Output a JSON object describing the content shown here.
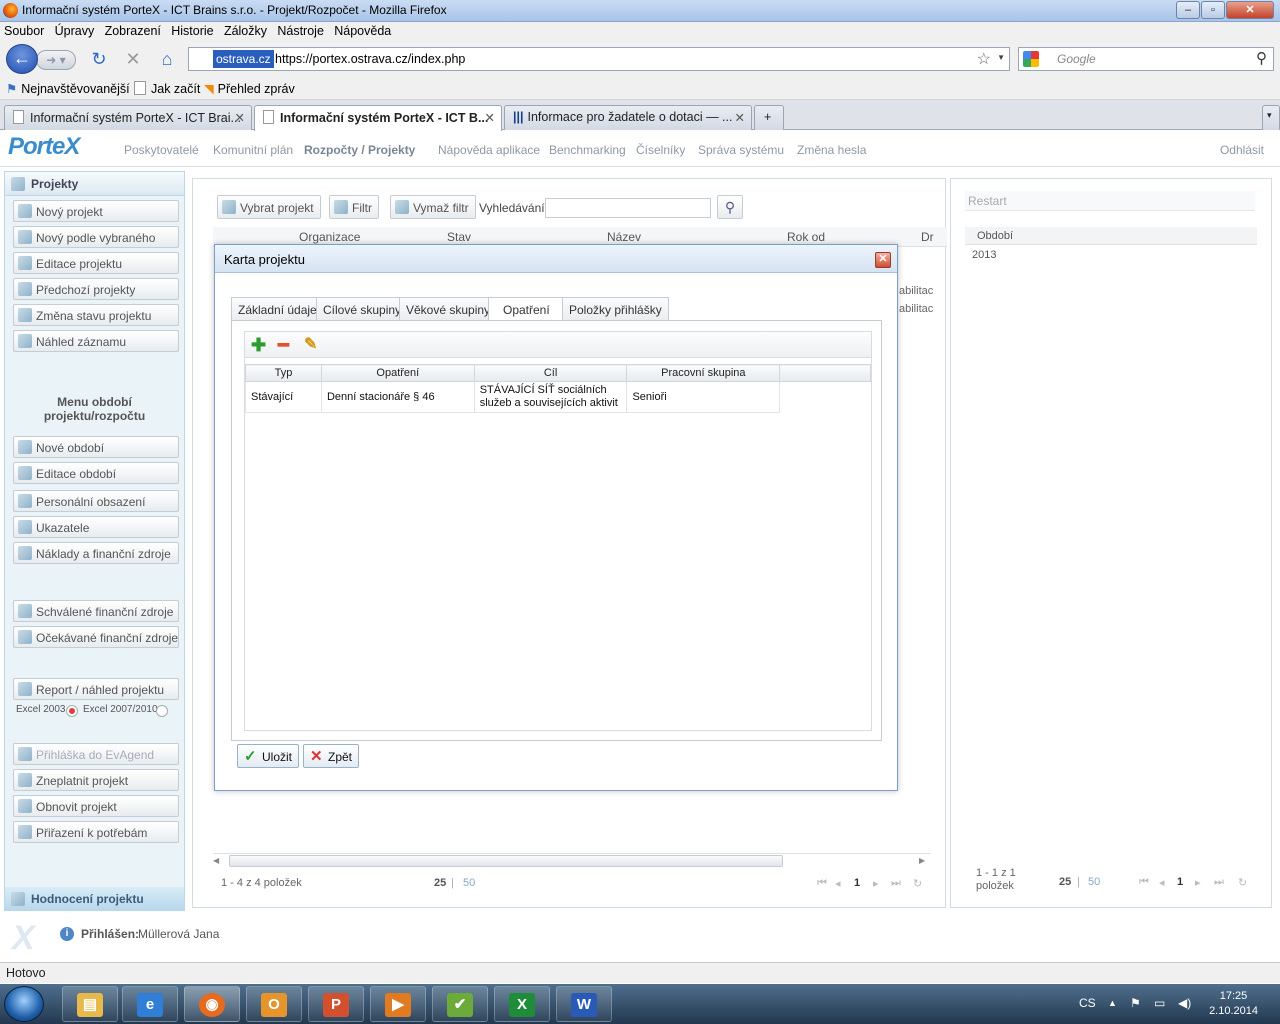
{
  "window": {
    "title": "Informační systém PorteX - ICT Brains s.r.o. - Projekt/Rozpočet - Mozilla Firefox"
  },
  "menu": [
    "Soubor",
    "Úpravy",
    "Zobrazení",
    "Historie",
    "Záložky",
    "Nástroje",
    "Nápověda"
  ],
  "nav": {
    "site_label": "ostrava.cz",
    "url": "https://portex.ostrava.cz/index.php",
    "search_placeholder": "Google"
  },
  "bookmarks": [
    "Nejnavštěvovanější",
    "Jak začít",
    "Přehled zpráv"
  ],
  "browser_tabs": [
    {
      "label": "Informační systém PorteX - ICT Brai..."
    },
    {
      "label": "Informační systém PorteX - ICT B..."
    },
    {
      "label": "Informace pro žadatele o dotaci — ..."
    }
  ],
  "app": {
    "logo": "PorteX",
    "top_nav": [
      "Poskytovatelé",
      "Komunitní plán",
      "Rozpočty / Projekty",
      "Nápověda aplikace",
      "Benchmarking",
      "Číselníky",
      "Správa systému",
      "Změna hesla"
    ],
    "logout": "Odhlásit"
  },
  "sidebar": {
    "title": "Projekty",
    "project_items": [
      "Nový projekt",
      "Nový podle vybraného",
      "Editace projektu",
      "Předchozí projekty",
      "Změna stavu projektu",
      "Náhled záznamu"
    ],
    "period_title": "Menu období projektu/rozpočtu",
    "period_items": [
      "Nové období",
      "Editace období",
      "Personální obsazení",
      "Ukazatele",
      "Náklady a finanční zdroje"
    ],
    "finance_items": [
      "Schválené finanční zdroje",
      "Očekávané finanční zdroje"
    ],
    "report_item": "Report / náhled projektu",
    "excel_2003": "Excel 2003",
    "excel_2007": "Excel 2007/2010",
    "bottom_items": [
      "Přihláška do EvAgend",
      "Zneplatnit projekt",
      "Obnovit projekt",
      "Přiřazení k potřebám"
    ],
    "footer": "Hodnocení projektu"
  },
  "main": {
    "toolbar": {
      "select": "Vybrat projekt",
      "filter": "Filtr",
      "clear_filter": "Vymaž filtr",
      "search_label": "Vyhledávání:"
    },
    "columns": [
      "Organizace",
      "Stav",
      "Název",
      "Rok od",
      "Dr"
    ],
    "row_fragments": [
      "abilitac",
      "abilitac"
    ],
    "pager": {
      "info": "1 - 4 z 4 položek",
      "size_a": "25",
      "size_b": "50",
      "page": "1"
    }
  },
  "right": {
    "restart": "Restart",
    "column": "Období",
    "value": "2013",
    "pager": {
      "info": "1 - 1 z 1 položek",
      "size_a": "25",
      "size_b": "50",
      "page": "1"
    }
  },
  "dialog": {
    "title": "Karta projektu",
    "tabs": [
      "Základní údaje",
      "Cílové skupiny",
      "Věkové skupiny",
      "Opatření",
      "Položky přihlášky"
    ],
    "active_tab": "Opatření",
    "grid_columns": [
      "Typ",
      "Opatření",
      "Cíl",
      "Pracovní skupina"
    ],
    "grid_rows": [
      {
        "typ": "Stávající",
        "opatreni": "Denní stacionáře § 46",
        "cil": "STÁVAJÍCÍ SÍŤ sociálních služeb a souvisejících aktivit",
        "skupina": "Senioři"
      }
    ],
    "save": "Uložit",
    "back": "Zpět"
  },
  "footer": {
    "logged_label": "Přihlášen:",
    "user": "Müllerová Jana"
  },
  "status": "Hotovo",
  "taskbar": {
    "lang": "CS",
    "time": "17:25",
    "date": "2.10.2014"
  }
}
